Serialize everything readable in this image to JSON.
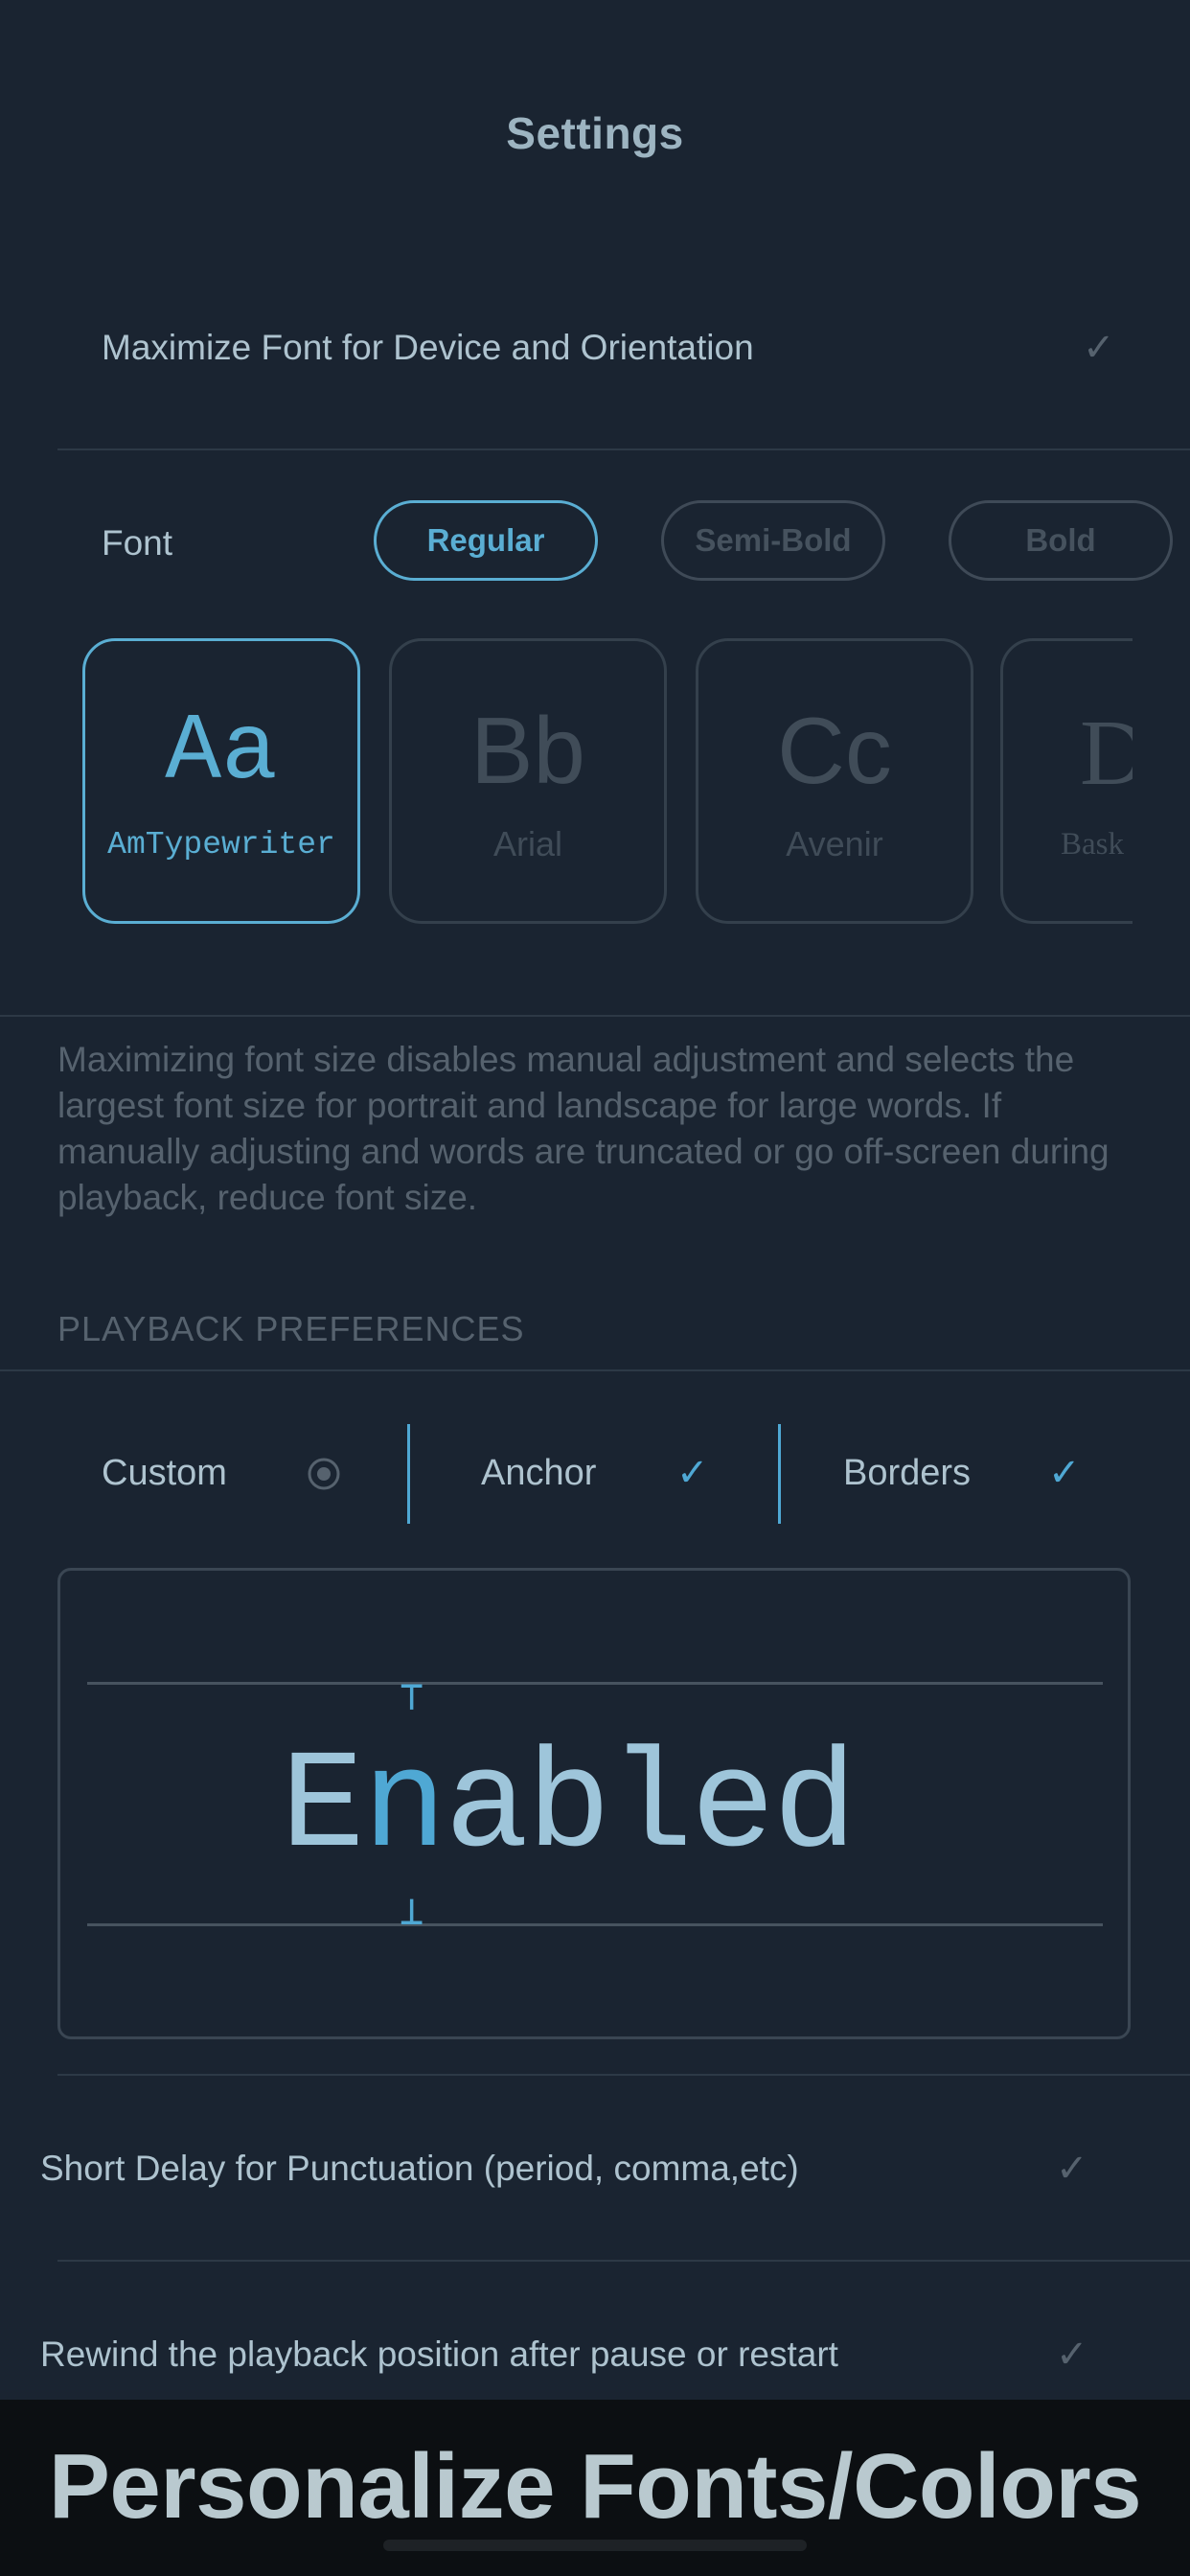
{
  "header": {
    "title": "Settings"
  },
  "maximize_row": {
    "label": "Maximize Font for Device and Orientation",
    "checked": true
  },
  "font_row": {
    "label": "Font",
    "weights": [
      {
        "label": "Regular",
        "selected": true
      },
      {
        "label": "Semi-Bold",
        "selected": false
      },
      {
        "label": "Bold",
        "selected": false
      }
    ]
  },
  "font_cards": [
    {
      "sample": "Aa",
      "name": "AmTypewriter",
      "selected": true
    },
    {
      "sample": "Bb",
      "name": "Arial",
      "selected": false
    },
    {
      "sample": "Cc",
      "name": "Avenir",
      "selected": false
    },
    {
      "sample": "D",
      "name": "Bask",
      "selected": false
    }
  ],
  "note": "Maximizing font size disables manual adjustment and selects the largest font size for portrait and landscape for large words.  If manually adjusting and words are truncated or go off-screen during playback, reduce font size.",
  "playback": {
    "section_title": "PLAYBACK PREFERENCES",
    "segments": [
      {
        "label": "Custom",
        "state": "radio"
      },
      {
        "label": "Anchor",
        "state": "checked"
      },
      {
        "label": "Borders",
        "state": "checked"
      }
    ],
    "preview": {
      "prefix": "E",
      "highlight": "n",
      "suffix": "abled",
      "tick_top": "⊤",
      "tick_bottom": "⊥"
    }
  },
  "options": [
    {
      "label": "Short Delay for Punctuation (period, comma,etc)",
      "checked": true
    },
    {
      "label": "Rewind the playback position after pause or restart",
      "checked": true
    }
  ],
  "icons": {
    "check": "✓"
  },
  "banner": {
    "text": "Personalize Fonts/Colors"
  },
  "colors": {
    "background": "#1a2431",
    "accent": "#5aaed3",
    "muted": "#56626e",
    "text": "#aec3cf"
  }
}
